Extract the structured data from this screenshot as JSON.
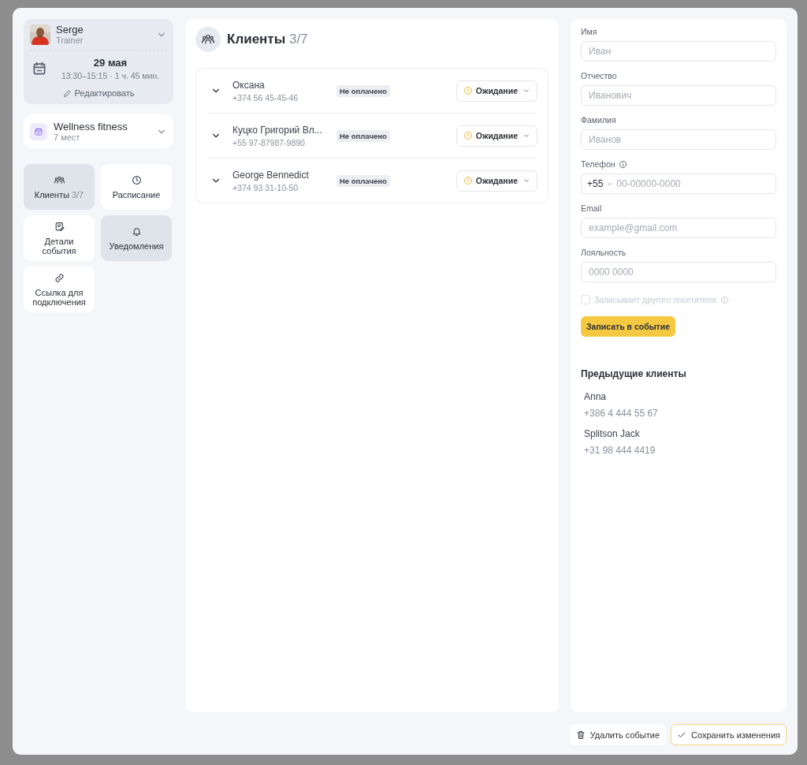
{
  "trainer": {
    "name": "Serge",
    "role": "Trainer",
    "date": "29 мая",
    "time": "13:30–15:15 · 1 ч. 45 мин.",
    "edit": "Редактировать"
  },
  "class": {
    "name": "Wellness fitness",
    "places": "7 мест"
  },
  "nav": [
    {
      "kind": "clients",
      "label": "Клиенты",
      "count": "3/7",
      "selected": true
    },
    {
      "kind": "schedule",
      "label": "Расписание",
      "selected": false
    },
    {
      "kind": "details",
      "label": "Детали события",
      "selected": false
    },
    {
      "kind": "notifications",
      "label": "Уведомления",
      "selected": true
    },
    {
      "kind": "link",
      "label": "Ссылка для подключения",
      "selected": false
    }
  ],
  "clients_panel": {
    "title": "Клиенты",
    "count": "3/7",
    "rows": [
      {
        "name": "Оксана",
        "phone": "+374 56 45-45-46",
        "payment": "Не оплачено",
        "status": "Ожидание",
        "expanded": false
      },
      {
        "name": "Куцко Григорий Вл...",
        "phone": "+55 97-87987-9890",
        "payment": "Не оплачено",
        "status": "Ожидание",
        "expanded": false
      },
      {
        "name": "George Bennedict",
        "phone": "+374 93 31-10-50",
        "payment": "Не оплачено",
        "status": "Ожидание",
        "expanded": false
      }
    ]
  },
  "form": {
    "fields": [
      {
        "kind": "text",
        "label": "Имя",
        "placeholder": "Иван"
      },
      {
        "kind": "text",
        "label": "Отчество",
        "placeholder": "Иванович"
      },
      {
        "kind": "text",
        "label": "Фамилия",
        "placeholder": "Иванов"
      },
      {
        "kind": "phone",
        "label": "Телефон",
        "code": "+55",
        "placeholder": "00-00000-0000"
      },
      {
        "kind": "text",
        "label": "Email",
        "placeholder": "example@gmail.com"
      },
      {
        "kind": "text",
        "label": "Лояльность",
        "placeholder": "0000 0000"
      }
    ],
    "other_visitor": {
      "label": "Записывает другого посетителя",
      "checked": false,
      "disabled": true
    },
    "submit": "Записать в событие"
  },
  "previous": {
    "title": "Предыдущие клиенты",
    "clients": [
      {
        "name": "Anna",
        "phone": "+386 4 444 55 67"
      },
      {
        "name": "Splitson Jack",
        "phone": "+31 98 444 4419"
      }
    ]
  },
  "footer": {
    "delete": "Удалить событие",
    "save": "Сохранить изменения"
  }
}
